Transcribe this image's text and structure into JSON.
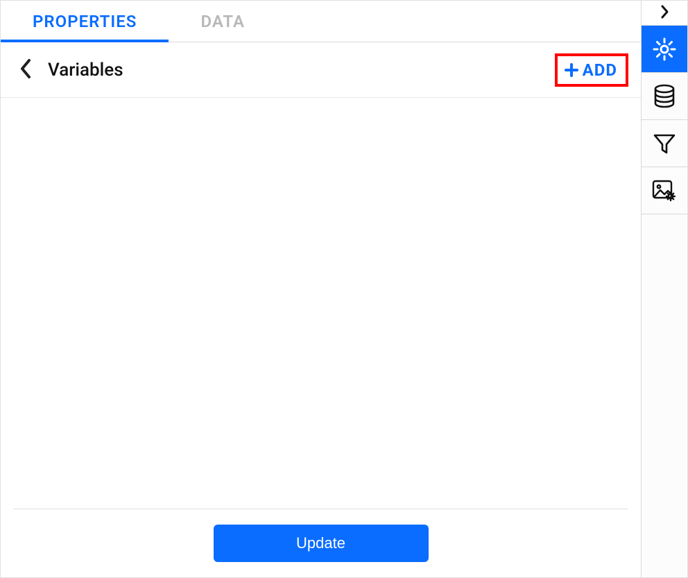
{
  "tabs": {
    "properties": "PROPERTIES",
    "data": "DATA",
    "active": "properties"
  },
  "section": {
    "title": "Variables",
    "add_label": "ADD"
  },
  "footer": {
    "update_label": "Update"
  },
  "side_toolbar": {
    "collapse_icon": "chevron-right",
    "items": [
      {
        "name": "settings",
        "icon": "gear-icon",
        "active": true
      },
      {
        "name": "data",
        "icon": "database-icon",
        "active": false
      },
      {
        "name": "filter",
        "icon": "filter-icon",
        "active": false
      },
      {
        "name": "image-settings",
        "icon": "image-gear-icon",
        "active": false
      }
    ]
  },
  "colors": {
    "accent": "#0a6dff",
    "highlight_border": "#ff0000"
  }
}
